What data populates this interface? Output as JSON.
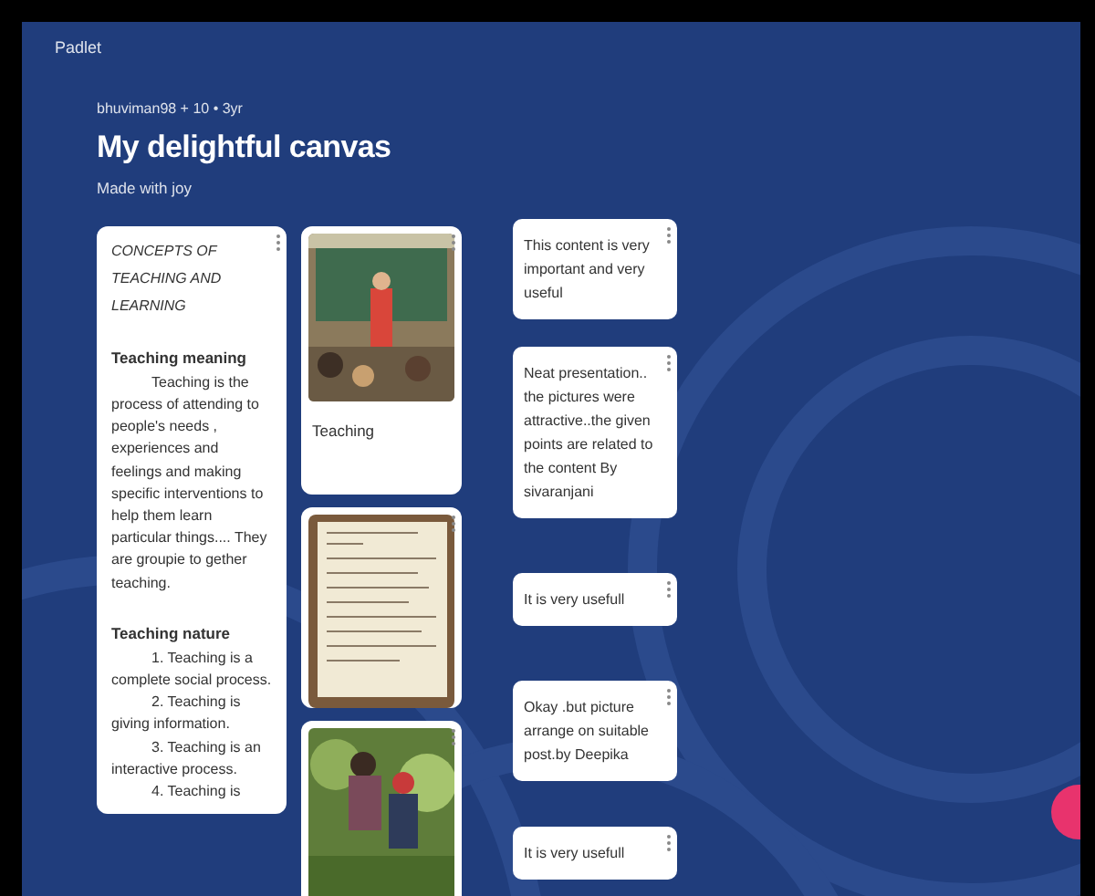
{
  "app": {
    "logo": "Padlet"
  },
  "header": {
    "byline": "bhuviman98 + 10 • 3yr",
    "title": "My delightful canvas",
    "subtitle": "Made with joy"
  },
  "columns": [
    {
      "posts": [
        {
          "kind": "article",
          "title": "CONCEPTS OF TEACHING AND LEARNING",
          "sections": [
            {
              "heading": "Teaching meaning",
              "paragraphs": [
                "Teaching is the process of attending  to people's needs , experiences and feelings and making specific interventions to help them learn particular things.... They are groupie to gether teaching."
              ]
            },
            {
              "heading": "Teaching nature",
              "paragraphs": [
                "1. Teaching is a complete social process.",
                "2. Teaching is giving information.",
                "3. Teaching is an interactive process.",
                "4. Teaching is"
              ]
            }
          ]
        }
      ]
    },
    {
      "posts": [
        {
          "kind": "classroom",
          "caption": "Teaching"
        },
        {
          "kind": "slide"
        },
        {
          "kind": "garden"
        }
      ]
    },
    {
      "posts": [
        {
          "kind": "comment",
          "text": "This content is very important and very useful"
        },
        {
          "kind": "comment",
          "text": "Neat presentation.. the pictures were attractive..the given points are related to the content By sivaranjani"
        },
        {
          "kind": "comment",
          "text": "It is very usefull"
        },
        {
          "kind": "comment",
          "text": "Okay .but picture arrange on suitable post.by Deepika"
        },
        {
          "kind": "comment",
          "text": "It is very usefull"
        }
      ]
    }
  ]
}
